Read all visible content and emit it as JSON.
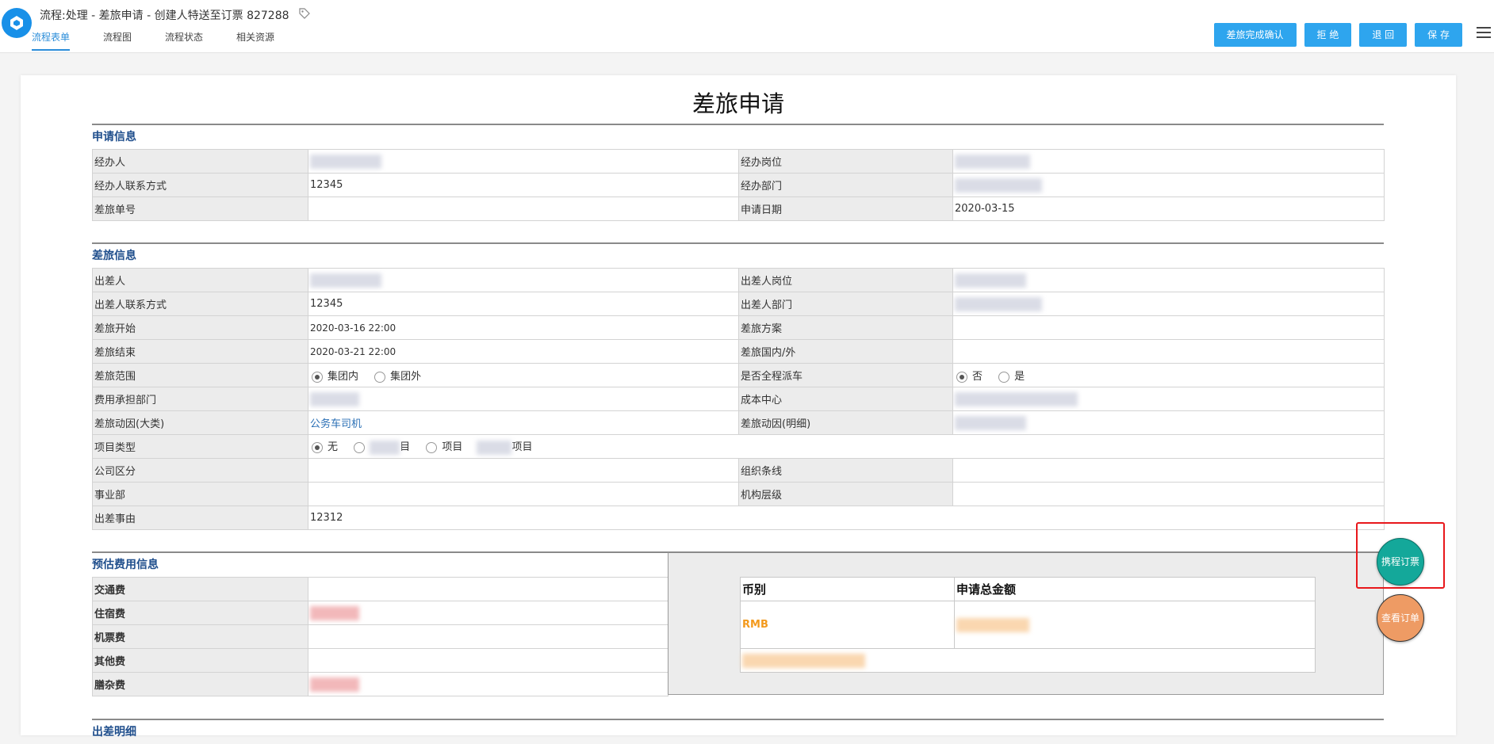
{
  "header": {
    "title": "流程:处理 - 差旅申请 - 创建人特送至订票 827288",
    "tabs": [
      "流程表单",
      "流程图",
      "流程状态",
      "相关资源"
    ],
    "actions": [
      "差旅完成确认",
      "拒 绝",
      "退 回",
      "保 存"
    ]
  },
  "form": {
    "title": "差旅申请",
    "apply_section": {
      "heading": "申请信息",
      "rows": [
        [
          "经办人",
          "",
          "经办岗位",
          ""
        ],
        [
          "经办人联系方式",
          "12345",
          "经办部门",
          ""
        ],
        [
          "差旅单号",
          "",
          "申请日期",
          "2020-03-15"
        ]
      ]
    },
    "travel_section": {
      "heading": "差旅信息",
      "traveler": "出差人",
      "traveler_post": "出差人岗位",
      "contact_label": "出差人联系方式",
      "contact_value": "12345",
      "dept_label": "出差人部门",
      "start_label": "差旅开始",
      "start_value": "2020-03-16 22:00",
      "plan_label": "差旅方案",
      "end_label": "差旅结束",
      "end_value": "2020-03-21 22:00",
      "domestic_label": "差旅国内/外",
      "scope_label": "差旅范围",
      "scope_opt1": "集团内",
      "scope_opt2": "集团外",
      "car_label": "是否全程派车",
      "car_opt1": "否",
      "car_opt2": "是",
      "fee_dept_label": "费用承担部门",
      "cost_center_label": "成本中心",
      "reason_big_label": "差旅动因(大类)",
      "reason_big_value": "公务车司机",
      "reason_detail_label": "差旅动因(明细)",
      "project_type_label": "项目类型",
      "project_opt1": "无",
      "project_opt2": "目",
      "project_opt3": "项目",
      "project_opt4": "项目",
      "company_label": "公司区分",
      "org_line_label": "组织条线",
      "division_label": "事业部",
      "org_level_label": "机构层级",
      "reason_label": "出差事由",
      "reason_value": "12312"
    },
    "estimate_section": {
      "heading": "预估费用信息",
      "items": [
        "交通费",
        "住宿费",
        "机票费",
        "其他费",
        "膳杂费"
      ],
      "currency_header": "币别",
      "total_header": "申请总金额",
      "currency": "RMB"
    },
    "next_section_heading": "出差明细"
  },
  "floating": {
    "book_button": "携程订票",
    "view_order_button": "查看订单"
  },
  "colors": {
    "accent": "#2ea5ee",
    "section_heading": "#1f4e8c",
    "book_button": "#14a89a",
    "view_order_button": "#ee9b64",
    "highlight_box": "#e8171b",
    "currency": "#f39a1d"
  }
}
